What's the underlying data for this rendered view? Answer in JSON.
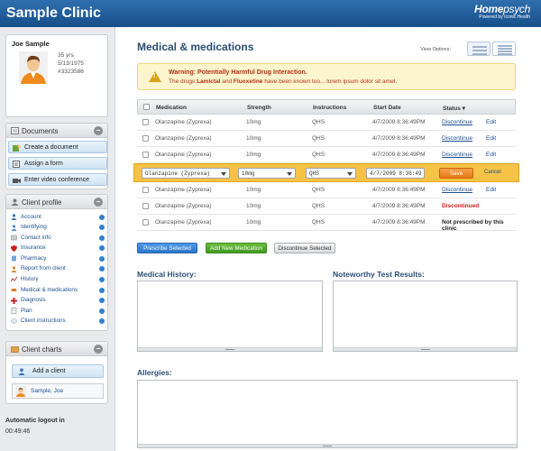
{
  "app": {
    "title": "Sample Clinic",
    "brand": {
      "name_prefix": "Home",
      "name_suffix": "psych",
      "tagline": "Powered by Iconic Health"
    }
  },
  "patient": {
    "name": "Joe Sample",
    "age": "35 yrs",
    "dob": "5/13/1975",
    "id": "#3323586"
  },
  "documents": {
    "title": "Documents",
    "toggle": "−",
    "buttons": [
      "Create a document",
      "Assign a form",
      "Enter video conference"
    ]
  },
  "client_profile": {
    "title": "Client profile",
    "toggle": "−",
    "items": [
      "Account",
      "Identifying",
      "Contact info",
      "Insurance",
      "Pharmacy",
      "Report from client",
      "History",
      "Medical & medications",
      "Diagnosis",
      "Plan",
      "Client instructions"
    ]
  },
  "client_charts": {
    "title": "Client charts",
    "toggle": "−",
    "add_label": "Add a client",
    "client_name": "Sample, Joe"
  },
  "logout": {
    "label": "Automatic logout in",
    "time": "00:49:46"
  },
  "main": {
    "title": "Medical & medications",
    "view_options_label": "View Options:",
    "warning": {
      "title": "Warning: Potentially Harmful Drug Interaction.",
      "body_prefix": "The drugs ",
      "drug1": "Lamictal",
      "and": " and ",
      "drug2": "Fluoxetine",
      "body_suffix": " have been known too... lorem ipsum dolor sit amet."
    },
    "table": {
      "headers": [
        "Medication",
        "Strength",
        "Instructions",
        "Start Date",
        "Status"
      ],
      "rows": [
        {
          "medication": "Olanzapine (Zyprexa)",
          "strength": "10mg",
          "instructions": "QHS",
          "start": "4/7/2009 8:36:49PM",
          "status": "Discontinue",
          "action": "Edit"
        },
        {
          "medication": "Olanzapine (Zyprexa)",
          "strength": "10mg",
          "instructions": "QHS",
          "start": "4/7/2009 8:36:49PM",
          "status": "Discontinue",
          "action": "Edit"
        },
        {
          "medication": "Olanzapine (Zyprexa)",
          "strength": "10mg",
          "instructions": "QHS",
          "start": "4/7/2009 8:36:49PM",
          "status": "Discontinue",
          "action": "Edit"
        }
      ],
      "edit_row": {
        "medication": "Olanzapine (Zyprexa)",
        "strength": "10mg",
        "instructions": "QHS",
        "start": "4/7/2009 8:36:49",
        "save": "Save",
        "cancel": "Cancel"
      },
      "rows_after": [
        {
          "medication": "Olanzapine (Zyprexa)",
          "strength": "10mg",
          "instructions": "QHS",
          "start": "4/7/2009 8:36:49PM",
          "status": "Discontinue",
          "action": "Edit"
        },
        {
          "medication": "Olanzapine (Zyprexa)",
          "strength": "10mg",
          "instructions": "QHS",
          "start": "4/7/2009 8:36:49PM",
          "status": "Discontinued",
          "action": ""
        },
        {
          "medication": "Olanzapine (Zyprexa)",
          "strength": "10mg",
          "instructions": "QHS",
          "start": "4/7/2009 8:36:49PM",
          "status": "Not prescribed by this clinic",
          "action": ""
        }
      ]
    },
    "buttons": {
      "prescribe": "Prescribe Selected",
      "add": "Add New Medication",
      "discontinue": "Discontinue Selected"
    },
    "sections": {
      "history": "Medical History:",
      "tests": "Noteworthy Test Results:",
      "allergies": "Allergies:"
    }
  }
}
